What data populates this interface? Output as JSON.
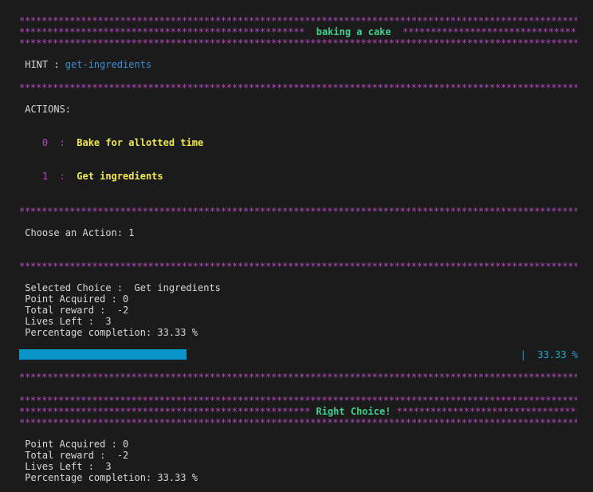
{
  "stars_full": "************************************************************************************************************************************",
  "header": {
    "stars_left": "***************************************************",
    "title": "  baking a cake  ",
    "stars_right": "**************************************************************"
  },
  "hint": {
    "label": " HINT : ",
    "value": "get-ingredients"
  },
  "actions": {
    "heading": " ACTIONS:",
    "items": [
      {
        "index": "    0  :  ",
        "label": "Bake for allotted time"
      },
      {
        "index": "    1  :  ",
        "label": "Get ingredients"
      }
    ]
  },
  "prompt": " Choose an Action: 1",
  "results": {
    "selected": " Selected Choice :  Get ingredients",
    "points": " Point Acquired : 0",
    "reward": " Total reward :  -2",
    "lives": " Lives Left :  3",
    "percent": " Percentage completion: 33.33 %"
  },
  "progress": {
    "fraction": 0.3333,
    "label": "|  33.33 %"
  },
  "banner": {
    "stars_left": "****************************************************",
    "title": " Right Choice! ",
    "stars_right": "*************************************************************"
  },
  "final": {
    "points": " Point Acquired : 0",
    "reward": " Total reward :  -2",
    "lives": " Lives Left :  3",
    "percent": " Percentage completion: 33.33 %"
  },
  "colors": {
    "background": "#1b1b1b",
    "stars": "#b54bbf",
    "title": "#3fd08c",
    "hint": "#3a8fd6",
    "action_label": "#f2ea52",
    "progress": "#0a96c8"
  }
}
